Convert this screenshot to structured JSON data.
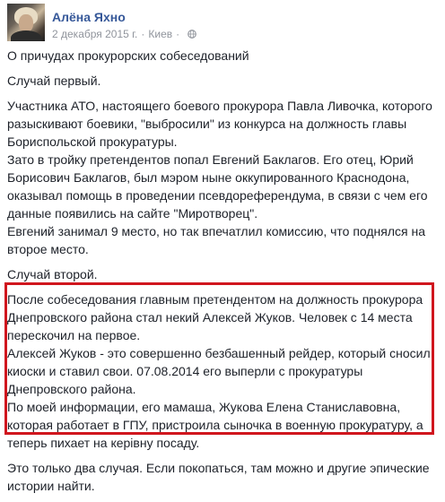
{
  "post": {
    "author": "Алёна Яхно",
    "date": "2 декабря 2015 г.",
    "separator": "·",
    "location": "Киев",
    "privacy_icon": "globe-icon"
  },
  "body": {
    "title": "О причудах прокурорских собеседований",
    "case1_heading": "Случай первый.",
    "case1_lines": [
      "Участника АТО, настоящего боевого прокурора Павла Ливочка, которого",
      "разыскивают боевики, \"выбросили\" из конкурса на должность главы",
      "Бориспольской прокуратуры.",
      "Зато в тройку претендентов попал Евгений Баклагов. Его отец, Юрий",
      "Борисович Баклагов, был мэром ныне оккупированного Краснодона,",
      "оказывал помощь в проведении псевдореферендума, в связи с чем его",
      "данные появились на сайте \"Миротворец\".",
      "Евгений занимал 9 место, но так впечатлил комиссию, что поднялся на",
      "второе место."
    ],
    "case2_heading": "Случай второй.",
    "case2_lines": [
      "После собеседования главным претендентом на должность прокурора",
      "Днепровского района стал некий Алексей Жуков. Человек с 14 места",
      "перескочил на первое.",
      "Алексей Жуков - это совершенно безбашенный рейдер, который сносил",
      "киоски и ставил свои. 07.08.2014 его выперли с прокуратуры",
      "Днепровского района.",
      "По моей информации, его мамаша, Жукова Елена Станиславовна,",
      "которая работает в ГПУ, пристроила сыночка в военную прокуратуру, а",
      "теперь пихает на керівну посаду."
    ],
    "closing_lines": [
      "Это только два случая. Если покопаться, там можно и другие эпические",
      "истории найти."
    ]
  },
  "colors": {
    "author": "#365899",
    "meta": "#90949c",
    "text": "#1d2129",
    "highlight_border": "#d0161e"
  }
}
